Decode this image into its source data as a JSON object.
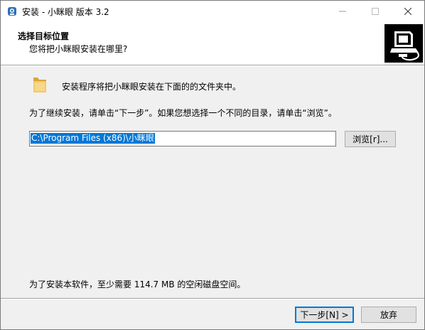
{
  "window": {
    "title": "安装 - 小眯眼 版本 3.2",
    "controls": {
      "minimize": "–",
      "maximize": "☐",
      "close": "✕"
    }
  },
  "header": {
    "title": "选择目标位置",
    "subtitle": "您将把小眯眼安装在哪里?",
    "image_icon": "installer-computer-icon"
  },
  "body": {
    "folder_icon": "folder-icon",
    "info_text": "安装程序将把小眯眼安装在下面的的文件夹中。",
    "instruction_text": "为了继续安装，请单击“下一步”。如果您想选择一个不同的目录，请单击“浏览”。",
    "install_path": "C:\\Program Files (x86)\\小眯眼",
    "browse_label": "浏览[r]...",
    "space_text": "为了安装本软件，至少需要 114.7 MB 的空闲磁盘空间。"
  },
  "footer": {
    "next_label": "下一步[N] >",
    "cancel_label": "放弃"
  },
  "colors": {
    "selection": "#0078d7",
    "folder": "#e8b84a"
  }
}
